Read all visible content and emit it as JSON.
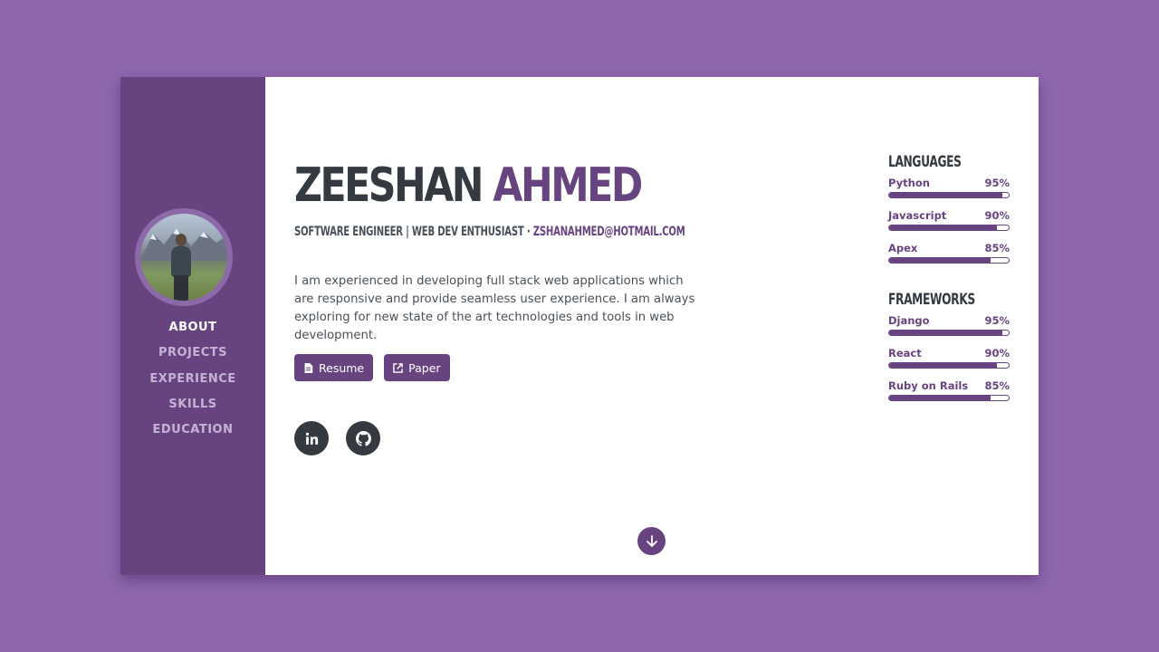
{
  "sidebar": {
    "nav": [
      "ABOUT",
      "PROJECTS",
      "EXPERIENCE",
      "SKILLS",
      "EDUCATION"
    ]
  },
  "header": {
    "first_name": "ZEESHAN",
    "last_name": "AHMED",
    "subtitle": "SOFTWARE ENGINEER | WEB DEV ENTHUSIAST · ",
    "email": "ZSHANAHMED@HOTMAIL.COM"
  },
  "bio": "I am experienced in developing full stack web applications which are responsive and provide seamless user experience. I am always exploring for new state of the art technologies and tools in web development.",
  "buttons": {
    "resume": "Resume",
    "paper": "Paper"
  },
  "icons": {
    "resume": "file-pdf-icon",
    "paper": "external-link-icon",
    "linkedin": "linkedin-icon",
    "github": "github-icon",
    "scroll": "arrow-down-icon"
  },
  "skills": {
    "languages_title": "LANGUAGES",
    "languages": [
      {
        "name": "Python",
        "percent_label": "95%",
        "level": 0.95
      },
      {
        "name": "Javascript",
        "percent_label": "90%",
        "level": 0.9
      },
      {
        "name": "Apex",
        "percent_label": "85%",
        "level": 0.85
      }
    ],
    "frameworks_title": "FRAMEWORKS",
    "frameworks": [
      {
        "name": "Django",
        "percent_label": "95%",
        "level": 0.95
      },
      {
        "name": "React",
        "percent_label": "90%",
        "level": 0.9
      },
      {
        "name": "Ruby on Rails",
        "percent_label": "85%",
        "level": 0.85
      }
    ]
  },
  "colors": {
    "background": "#8e67ad",
    "sidebar": "#67447f",
    "accent": "#67447f",
    "dark": "#343a40"
  }
}
